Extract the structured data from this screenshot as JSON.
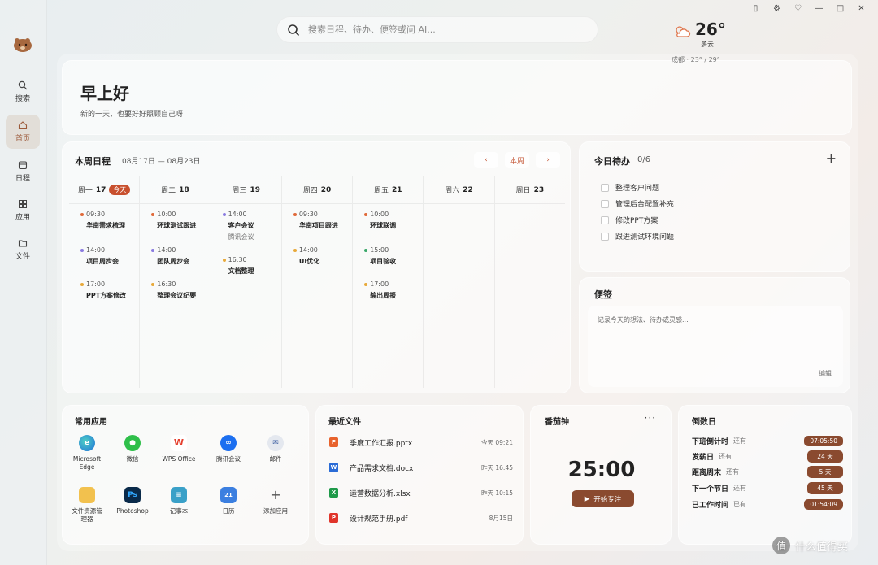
{
  "sidebar": {
    "items": [
      {
        "label": "搜索",
        "icon": "search-icon"
      },
      {
        "label": "首页",
        "icon": "home-icon"
      },
      {
        "label": "日程",
        "icon": "calendar-icon"
      },
      {
        "label": "应用",
        "icon": "apps-icon"
      },
      {
        "label": "文件",
        "icon": "folder-icon"
      }
    ]
  },
  "search": {
    "placeholder": "搜索日程、待办、便签或问 AI..."
  },
  "greeting": {
    "title": "早上好",
    "subtitle": "新的一天，也要好好照顾自己呀"
  },
  "weather": {
    "temp": "26°",
    "desc": "多云",
    "location": "成都 · 23° / 29°"
  },
  "schedule": {
    "title": "本周日程",
    "range": "08月17日 — 08月23日",
    "this_week": "本周",
    "days": [
      {
        "name": "周一",
        "date": "17",
        "today": "今天",
        "events": [
          {
            "time": "09:30",
            "title": "华南需求梳理",
            "sub": ""
          },
          {
            "time": "14:00",
            "title": "项目周步会",
            "sub": ""
          },
          {
            "time": "17:00",
            "title": "PPT方案修改",
            "sub": ""
          }
        ]
      },
      {
        "name": "周二",
        "date": "18",
        "events": [
          {
            "time": "10:00",
            "title": "环球测试跟进",
            "sub": ""
          },
          {
            "time": "14:00",
            "title": "团队周步会",
            "sub": ""
          },
          {
            "time": "16:30",
            "title": "整理会议纪要",
            "sub": ""
          }
        ]
      },
      {
        "name": "周三",
        "date": "19",
        "events": [
          {
            "time": "14:00",
            "title": "客户会议",
            "sub": "腾讯会议"
          },
          {
            "time": "16:30",
            "title": "文档整理",
            "sub": ""
          }
        ]
      },
      {
        "name": "周四",
        "date": "20",
        "events": [
          {
            "time": "09:30",
            "title": "华南项目跟进",
            "sub": ""
          },
          {
            "time": "14:00",
            "title": "UI优化",
            "sub": ""
          }
        ]
      },
      {
        "name": "周五",
        "date": "21",
        "events": [
          {
            "time": "10:00",
            "title": "环球联调",
            "sub": ""
          },
          {
            "time": "15:00",
            "title": "项目验收",
            "sub": ""
          },
          {
            "time": "17:00",
            "title": "输出周报",
            "sub": ""
          }
        ]
      },
      {
        "name": "周六",
        "date": "22",
        "events": []
      },
      {
        "name": "周日",
        "date": "23",
        "events": []
      }
    ]
  },
  "todo": {
    "title": "今日待办",
    "count": "0/6",
    "items": [
      "整理客户问题",
      "管理后台配置补充",
      "修改PPT方案",
      "跟进测试环境问题"
    ]
  },
  "notes": {
    "title": "便签",
    "placeholder": "记录今天的想法、待办或灵感...",
    "edit": "编辑"
  },
  "apps": {
    "title": "常用应用",
    "items": [
      {
        "label": "Microsoft Edge",
        "icon": "edge-icon",
        "color": "#1e88d8"
      },
      {
        "label": "微信",
        "icon": "wechat-icon",
        "color": "#2fbf4a"
      },
      {
        "label": "WPS Office",
        "icon": "wps-icon",
        "color": "#e5402f"
      },
      {
        "label": "腾讯会议",
        "icon": "tencent-meeting-icon",
        "color": "#1c6ff0"
      },
      {
        "label": "邮件",
        "icon": "mail-icon",
        "color": "#d8dde6"
      },
      {
        "label": "文件资源管理器",
        "icon": "file-explorer-icon",
        "color": "#f2c14e"
      },
      {
        "label": "Photoshop",
        "icon": "photoshop-icon",
        "color": "#0a2a4a"
      },
      {
        "label": "记事本",
        "icon": "notepad-icon",
        "color": "#3aa0c8"
      },
      {
        "label": "日历",
        "icon": "calendar-app-icon",
        "color": "#3b7fe0"
      },
      {
        "label": "添加应用",
        "icon": "plus-icon",
        "color": "transparent"
      }
    ]
  },
  "files": {
    "title": "最近文件",
    "items": [
      {
        "name": "季度工作汇报.pptx",
        "time": "今天 09:21",
        "icon": "ppt-icon",
        "color": "#e8632d"
      },
      {
        "name": "产品需求文档.docx",
        "time": "昨天 16:45",
        "icon": "word-icon",
        "color": "#2b6cd6"
      },
      {
        "name": "运营数据分析.xlsx",
        "time": "昨天 10:15",
        "icon": "excel-icon",
        "color": "#1f9a4a"
      },
      {
        "name": "设计规范手册.pdf",
        "time": "8月15日",
        "icon": "pdf-icon",
        "color": "#e0352b"
      }
    ]
  },
  "pomodoro": {
    "title": "番茄钟",
    "time": "25:00",
    "start": "开始专注"
  },
  "countdown": {
    "title": "倒数日",
    "items": [
      {
        "label": "下班倒计时",
        "note": "还有",
        "value": "07:05:50"
      },
      {
        "label": "发薪日",
        "note": "还有",
        "value": "24 天"
      },
      {
        "label": "距离周末",
        "note": "还有",
        "value": "5 天"
      },
      {
        "label": "下一个节日",
        "note": "还有",
        "value": "45 天"
      },
      {
        "label": "已工作时间",
        "note": "已有",
        "value": "01:54:09"
      }
    ]
  },
  "watermark": "什么值得买",
  "colors": {
    "accent": "#c8502e",
    "brown": "#8a4a2f"
  }
}
